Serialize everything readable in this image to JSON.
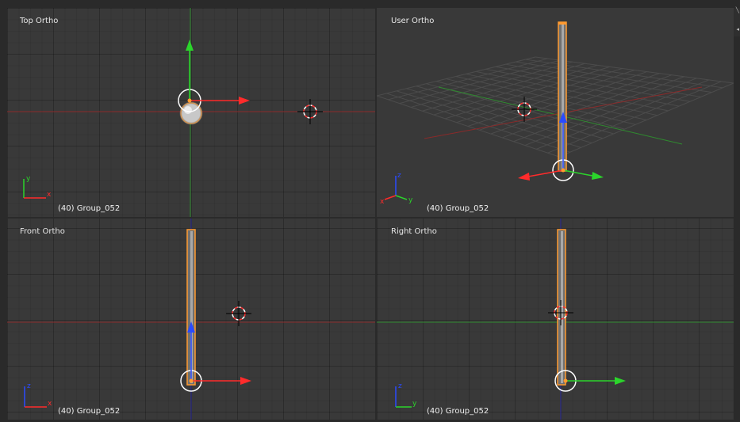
{
  "viewports": {
    "top_left": {
      "title": "Top Ortho",
      "status": "(40) Group_052"
    },
    "top_right": {
      "title": "User Ortho",
      "status": "(40) Group_052"
    },
    "bottom_left": {
      "title": "Front Ortho",
      "status": "(40) Group_052"
    },
    "bottom_right": {
      "title": "Right Ortho",
      "status": "(40) Group_052"
    }
  },
  "axis_labels": {
    "top_left": [
      "y",
      "x"
    ],
    "top_right": [
      "z",
      "x",
      "y"
    ],
    "bottom_left": [
      "z",
      "x"
    ],
    "bottom_right": [
      "z",
      "y"
    ]
  },
  "colors": {
    "x_axis": "#ff2b2b",
    "y_axis": "#2bd42b",
    "z_axis": "#2a4bff",
    "selection_outline": "#ff9a30",
    "viewport_bg": "#393939"
  },
  "icons": [
    "3d-cursor-icon",
    "transform-manipulator-icon",
    "axis-gizmo-icon",
    "viewport-corner-icon"
  ]
}
